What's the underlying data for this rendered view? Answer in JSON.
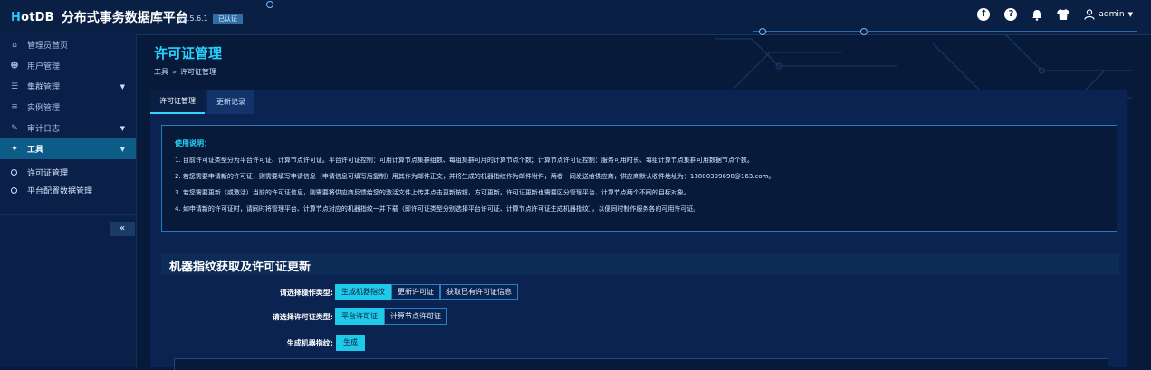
{
  "brand": {
    "logo_prefix": "H",
    "logo_rest": "otDB",
    "title": "分布式事务数据库平台",
    "version": "v2.5.6.1",
    "badge": "已认证"
  },
  "topbar": {
    "icons": [
      "upload-icon",
      "help-icon",
      "bell-icon",
      "shirt-icon",
      "user-icon"
    ],
    "user_name": "admin"
  },
  "sidebar": {
    "items": [
      {
        "label": "管理员首页",
        "icon": "home-icon"
      },
      {
        "label": "用户管理",
        "icon": "users-icon"
      },
      {
        "label": "集群管理",
        "icon": "cluster-icon",
        "expandable": true
      },
      {
        "label": "实例管理",
        "icon": "database-icon"
      },
      {
        "label": "审计日志",
        "icon": "edit-icon",
        "expandable": true
      },
      {
        "label": "工具",
        "icon": "wrench-icon",
        "expandable": true,
        "active": true
      }
    ],
    "subitems": [
      {
        "label": "许可证管理",
        "active": true
      },
      {
        "label": "平台配置数据管理"
      }
    ],
    "collapse": "«"
  },
  "main": {
    "title": "许可证管理",
    "breadcrumb": {
      "parent": "工具",
      "sep": "»",
      "current": "许可证管理"
    },
    "tabs": [
      {
        "label": "许可证管理",
        "active": true
      },
      {
        "label": "更新记录"
      }
    ],
    "info": {
      "title": "使用说明：",
      "lines": [
        "1. 目前许可证类型分为平台许可证、计算节点许可证。平台许可证控制：可用计算节点集群组数、每组集群可用的计算节点个数；计算节点许可证控制：服务可用时长、每组计算节点集群可用数据节点个数。",
        "2. 若您需要申请新的许可证，则需要填写申请信息（申请信息可填写后复制）用其作为邮件正文，并将生成的机器指纹作为邮件附件，两者一同发送给供应商，供应商默认收件地址为：18800399698@163.com。",
        "3. 若您需要更新（或激活）当前的许可证信息，则需要将供应商反馈给您的激活文件上传并点击更新按钮，方可更新。许可证更新也需要区分管理平台、计算节点两个不同的目标对象。",
        "4. 如申请新的许可证时，请同时将管理平台、计算节点对应的机器指纹一并下载（即许可证类型分别选择平台许可证、计算节点许可证生成机器指纹），以便同时制作服务各的可用许可证。"
      ]
    },
    "section_title": "机器指纹获取及许可证更新",
    "form": {
      "op_label": "请选择操作类型:",
      "op_options": [
        {
          "label": "生成机器指纹",
          "selected": true
        },
        {
          "label": "更新许可证"
        },
        {
          "label": "获取已有许可证信息"
        }
      ],
      "lic_label": "请选择许可证类型:",
      "lic_options": [
        {
          "label": "平台许可证",
          "selected": true
        },
        {
          "label": "计算节点许可证"
        }
      ],
      "gen_label": "生成机器指纹:",
      "gen_button": "生成"
    }
  },
  "colors": {
    "accent": "#1fc9e8",
    "title": "#26d3ff",
    "background": "#071a3a",
    "sidebar_active": "#0d5c88"
  }
}
